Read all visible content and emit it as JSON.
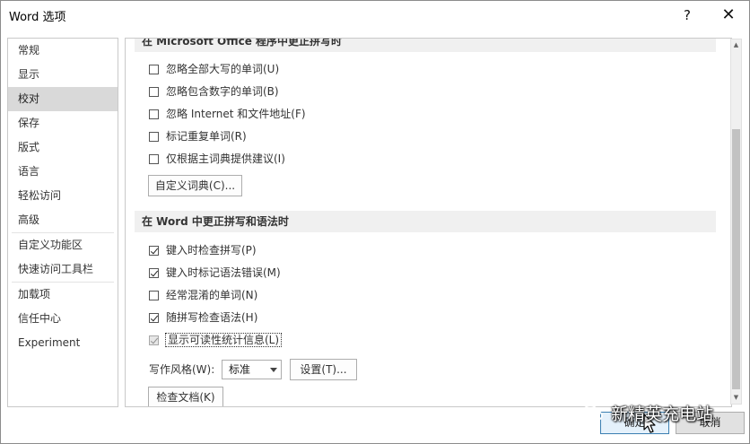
{
  "window": {
    "title": "Word 选项",
    "help_label": "?",
    "close_label": "✕"
  },
  "nav": {
    "items": [
      {
        "label": "常规"
      },
      {
        "label": "显示"
      },
      {
        "label": "校对",
        "selected": true
      },
      {
        "label": "保存"
      },
      {
        "label": "版式"
      },
      {
        "label": "语言"
      },
      {
        "label": "轻松访问"
      },
      {
        "label": "高级"
      },
      {
        "label": "自定义功能区"
      },
      {
        "label": "快速访问工具栏"
      },
      {
        "label": "加载项"
      },
      {
        "label": "信任中心"
      },
      {
        "label": "Experiment"
      }
    ]
  },
  "section1": {
    "header": "在 Microsoft Office 程序中更正拼写时",
    "options": [
      {
        "label": "忽略全部大写的单词(U)",
        "checked": false
      },
      {
        "label": "忽略包含数字的单词(B)",
        "checked": false
      },
      {
        "label": "忽略 Internet 和文件地址(F)",
        "checked": false
      },
      {
        "label": "标记重复单词(R)",
        "checked": false
      },
      {
        "label": "仅根据主词典提供建议(I)",
        "checked": false
      }
    ],
    "custom_dict_button": "自定义词典(C)..."
  },
  "section2": {
    "header": "在 Word 中更正拼写和语法时",
    "options": [
      {
        "label": "键入时检查拼写(P)",
        "checked": true
      },
      {
        "label": "键入时标记语法错误(M)",
        "checked": true
      },
      {
        "label": "经常混淆的单词(N)",
        "checked": false
      },
      {
        "label": "随拼写检查语法(H)",
        "checked": true
      },
      {
        "label": "显示可读性统计信息(L)",
        "checked": true,
        "disabled": true
      }
    ],
    "writing_style_label": "写作风格(W):",
    "writing_style_value": "标准",
    "settings_button": "设置(T)...",
    "check_document_button": "检查文档(K)"
  },
  "footer": {
    "ok_label": "确定",
    "cancel_label": "取消"
  },
  "watermark": {
    "text": "新精英充电站"
  },
  "colors": {
    "selected_nav": "#d9d9d9",
    "section_header_bg": "#f0f0f0",
    "ok_border": "#3c7fb1"
  }
}
